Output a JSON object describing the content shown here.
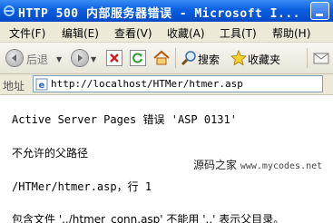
{
  "window": {
    "title": "HTTP 500 内部服务器错误 - Microsoft I..."
  },
  "menu": [
    "文件(F)",
    "编辑(E)",
    "查看(V)",
    "收藏(A)",
    "工具(T)",
    "帮助(H)"
  ],
  "toolbar": {
    "back_label": "后退",
    "search_label": "搜索",
    "favorites_label": "收藏夹"
  },
  "address": {
    "label": "地址",
    "url": "http://localhost/HTMer/htmer.asp"
  },
  "error": {
    "heading": "Active Server Pages 错误 'ASP 0131'",
    "message": "不允许的父路径",
    "location": "/HTMer/htmer.asp，行 1",
    "detail": "包含文件 '../htmer_conn.asp' 不能用 '..' 表示父目录。"
  },
  "watermark": {
    "name": "源码之家",
    "url": "www.mycodes.net"
  },
  "colors": {
    "titlebar": "#0a5fe0",
    "chrome": "#ece9d8"
  }
}
